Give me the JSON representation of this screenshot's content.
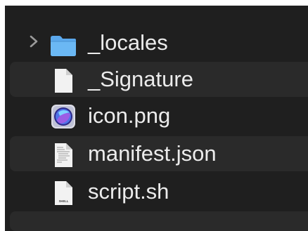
{
  "file_list": {
    "rows": [
      {
        "name": "_locales",
        "kind": "folder",
        "icon": "folder-icon",
        "disclosure": "chevron-right-icon"
      },
      {
        "name": "_Signature",
        "kind": "file",
        "icon": "document-icon"
      },
      {
        "name": "icon.png",
        "kind": "image",
        "icon": "png-image-icon"
      },
      {
        "name": "manifest.json",
        "kind": "file",
        "icon": "json-document-icon"
      },
      {
        "name": "script.sh",
        "kind": "file",
        "icon": "shell-script-icon",
        "icon_text": "SHELL"
      }
    ]
  },
  "colors": {
    "background": "#1f1f1f",
    "alternate_row": "#2a2a2a",
    "text": "#ececec",
    "folder": "#5ba8ec",
    "document": "#f2f2f2"
  }
}
